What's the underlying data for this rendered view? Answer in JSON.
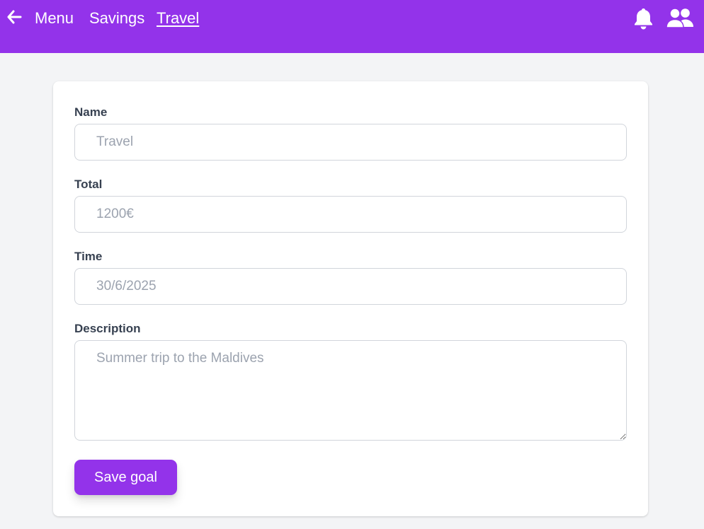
{
  "colors": {
    "brand": "#9333ea",
    "background": "#f3f4f6",
    "card": "#ffffff",
    "placeholder": "#9ca3af"
  },
  "header": {
    "back_icon": "arrow-left-icon",
    "breadcrumb": [
      "Menu",
      "Savings",
      "Travel"
    ],
    "active_crumb": "Travel",
    "notification_icon": "bell-icon",
    "users_icon": "users-icon"
  },
  "form": {
    "name": {
      "label": "Name",
      "placeholder": "Travel"
    },
    "total": {
      "label": "Total",
      "placeholder": "1200€"
    },
    "time": {
      "label": "Time",
      "placeholder": "30/6/2025"
    },
    "description": {
      "label": "Description",
      "placeholder": "Summer trip to the Maldives"
    },
    "save_label": "Save goal"
  }
}
